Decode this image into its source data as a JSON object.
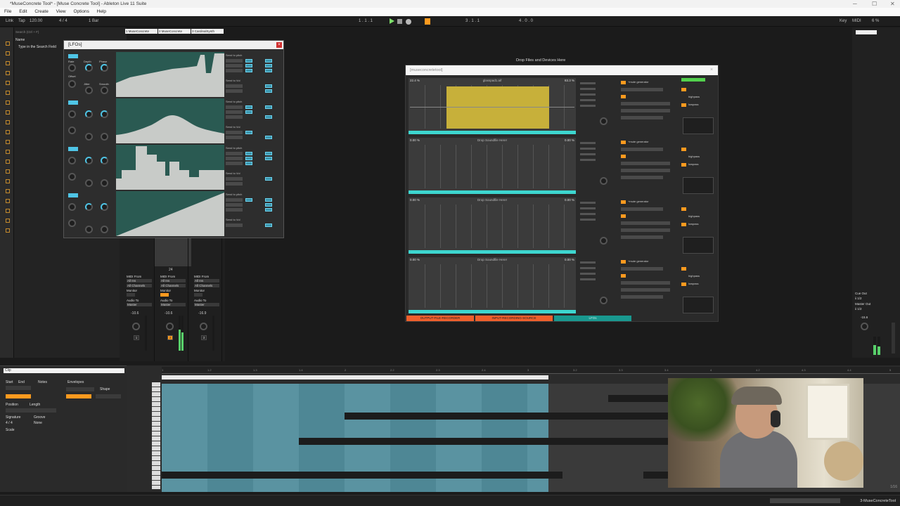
{
  "window": {
    "title": "*MuseConcrete Tool* - [Muse Concrete Tool] - Ableton Live 11 Suite"
  },
  "menu": [
    "File",
    "Edit",
    "Create",
    "View",
    "Options",
    "Help"
  ],
  "transport": {
    "link_label": "Link",
    "tap_label": "Tap",
    "tempo": "120.00",
    "time_sig": "4 / 4",
    "quantize": "1 Bar",
    "position": "1 . 1 . 1",
    "loop_start": "3 . 1 . 1",
    "loop_length": "4 . 0 . 0",
    "key_label": "Key",
    "midi_label": "MIDI",
    "cpu": "6 %"
  },
  "browser": {
    "search_placeholder": "Search (Ctrl + F)",
    "name_col": "Name",
    "search_hint": "Type in the Search Field"
  },
  "lfo_window": {
    "title": "[LFOs]",
    "close": "×",
    "rows": [
      {
        "sends": [
          "Send to pitch",
          "Send to Vol"
        ]
      },
      {
        "sends": [
          "Send to pitch",
          "Send to Vol"
        ]
      },
      {
        "sends": [
          "Send to pitch",
          "Send to Vol"
        ]
      },
      {
        "sends": [
          "Send to pitch",
          "Send to Vol"
        ]
      }
    ],
    "knob_labels": [
      "Rate",
      "Depth",
      "Phase",
      "Offset",
      "Jitter",
      "Smooth"
    ]
  },
  "track_tabs": [
    "1 MuseConcrete",
    "2 MuseConcrete",
    "3 CardinalSynth"
  ],
  "tracks": [
    {
      "midi_from": "MIDI From",
      "from_val": "All Ins",
      "channel": "All Channels",
      "monitor": "Monitor",
      "audio_to": "Audio To",
      "to_val": "Master",
      "volume": "-10.6",
      "num": "1"
    },
    {
      "midi_from": "MIDI From",
      "from_val": "All Ins",
      "channel": "All Channels",
      "monitor": "Monitor",
      "audio_to": "Audio To",
      "to_val": "Master",
      "volume": "-10.6",
      "num": "2"
    },
    {
      "midi_from": "MIDI From",
      "from_val": "All Ins",
      "channel": "All Channels",
      "monitor": "Monitor",
      "audio_to": "Audio To",
      "to_val": "Master",
      "volume": "-16.9",
      "num": "3"
    }
  ],
  "slot_counter": "24",
  "drop_hint": "Drop Files and Devices Here",
  "muse_window": {
    "title": "[museconcretetool]",
    "close": "×",
    "slots": [
      {
        "pct": "22.4 %",
        "file": "glasspad1.aif",
        "time": "83.3 %"
      },
      {
        "pct": "0.00 %",
        "file": "Drop Soundfile Here!",
        "time": "0.00 %"
      },
      {
        "pct": "0.00 %",
        "file": "Drop Soundfile Here!",
        "time": "0.00 %"
      },
      {
        "pct": "0.00 %",
        "file": "Drop Soundfile Here!",
        "time": "0.00 %"
      }
    ],
    "tabs": [
      "OUTPUT-FILE-RECORDER",
      "INPUT-RECORDING-SOURCE",
      "LFOs"
    ],
    "fx_label": "+mute generator",
    "filter_label": "highpass",
    "lowpass_label": "lowpass"
  },
  "master": {
    "cue_out": "Cue Out",
    "cue_val": "ii 1/2",
    "master_out": "Master Out",
    "master_val": "ii 1/2",
    "volume": "-15.6"
  },
  "clip_view": {
    "title": "Clip",
    "notes_label": "Notes",
    "envelopes_label": "Envelopes",
    "start_label": "Start",
    "end_label": "End",
    "position_label": "Position",
    "length_label": "Length",
    "signature_label": "Signature",
    "groove_label": "Groove",
    "scale_label": "Scale",
    "shape_label": "Shape",
    "sig_val": "4 / 4",
    "groove_val": "None"
  },
  "arrangement": {
    "ruler_ticks": [
      "1",
      "1.2",
      "1.3",
      "1.4",
      "2",
      "2.2",
      "2.3",
      "2.4",
      "3",
      "3.2",
      "3.3",
      "3.4",
      "4",
      "4.2",
      "4.3",
      "4.4",
      "5"
    ],
    "zoom_label": "1/16"
  },
  "status": {
    "right_text": "3-MuseConcreteTool"
  },
  "colors": {
    "accent_blue": "#4fc5e6",
    "accent_orange": "#ff9a1f",
    "teal": "#3dd6cf",
    "gold": "#c7b03a",
    "lfo_green": "#2a5a52"
  }
}
